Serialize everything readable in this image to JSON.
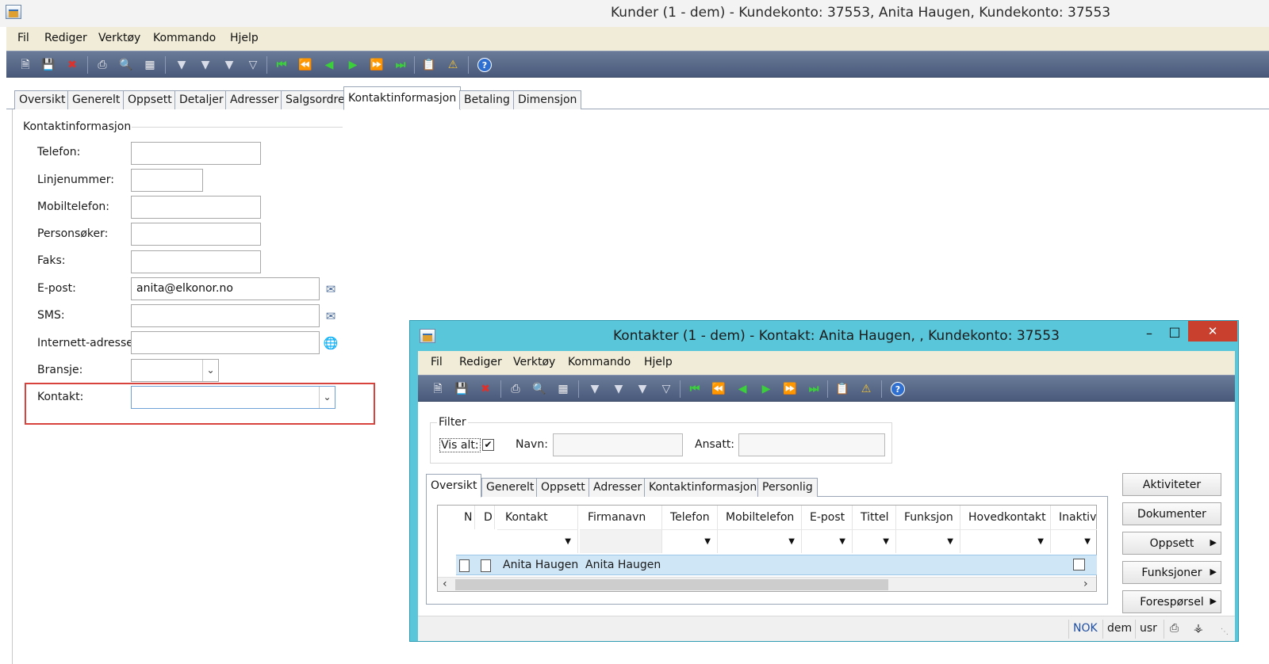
{
  "main_window": {
    "title": "Kunder (1 - dem) - Kundekonto: 37553, Anita Haugen, Kundekonto: 37553",
    "menu": [
      "Fil",
      "Rediger",
      "Verktøy",
      "Kommando",
      "Hjelp"
    ],
    "tabs": [
      "Oversikt",
      "Generelt",
      "Oppsett",
      "Detaljer",
      "Adresser",
      "Salgsordre",
      "Kontaktinformasjon",
      "Betaling",
      "Dimensjon"
    ],
    "active_tab": "Kontaktinformasjon",
    "group_title": "Kontaktinformasjon",
    "fields": {
      "telefon": {
        "label": "Telefon:",
        "value": ""
      },
      "linjenummer": {
        "label": "Linjenummer:",
        "value": ""
      },
      "mobiltelefon": {
        "label": "Mobiltelefon:",
        "value": ""
      },
      "personsoker": {
        "label": "Personsøker:",
        "value": ""
      },
      "faks": {
        "label": "Faks:",
        "value": ""
      },
      "epost": {
        "label": "E-post:",
        "value": "anita@elkonor.no"
      },
      "sms": {
        "label": "SMS:",
        "value": ""
      },
      "internett": {
        "label": "Internett-adresse:",
        "value": ""
      },
      "bransje": {
        "label": "Bransje:",
        "value": ""
      },
      "kontakt": {
        "label": "Kontakt:",
        "value": ""
      }
    }
  },
  "dialog": {
    "title": "Kontakter (1 - dem) - Kontakt: Anita Haugen, , Kundekonto: 37553",
    "window_buttons": {
      "minimize": "–",
      "maximize": "□",
      "close": "✕"
    },
    "menu": [
      "Fil",
      "Rediger",
      "Verktøy",
      "Kommando",
      "Hjelp"
    ],
    "filter": {
      "group_title": "Filter",
      "vis_alt_label": "Vis alt:",
      "vis_alt_checked": "✔",
      "navn_label": "Navn:",
      "navn_value": "",
      "ansatt_label": "Ansatt:",
      "ansatt_value": ""
    },
    "tabs": [
      "Oversikt",
      "Generelt",
      "Oppsett",
      "Adresser",
      "Kontaktinformasjon",
      "Personlig"
    ],
    "active_tab": "Oversikt",
    "grid": {
      "columns": [
        "N",
        "D",
        "Kontakt",
        "Firmanavn",
        "Telefon",
        "Mobiltelefon",
        "E-post",
        "Tittel",
        "Funksjon",
        "Hovedkontakt",
        "Inaktiv"
      ],
      "rows": [
        {
          "kontakt": "Anita Haugen",
          "firmanavn": "Anita Haugen",
          "telefon": "",
          "mobiltelefon": "",
          "epost": "",
          "tittel": "",
          "funksjon": "",
          "hovedkontakt": "",
          "inaktiv": ""
        }
      ]
    },
    "buttons": [
      "Aktiviteter",
      "Dokumenter",
      "Oppsett",
      "Funksjoner",
      "Forespørsel"
    ],
    "status": {
      "currency": "NOK",
      "company": "dem",
      "user": "usr"
    }
  }
}
